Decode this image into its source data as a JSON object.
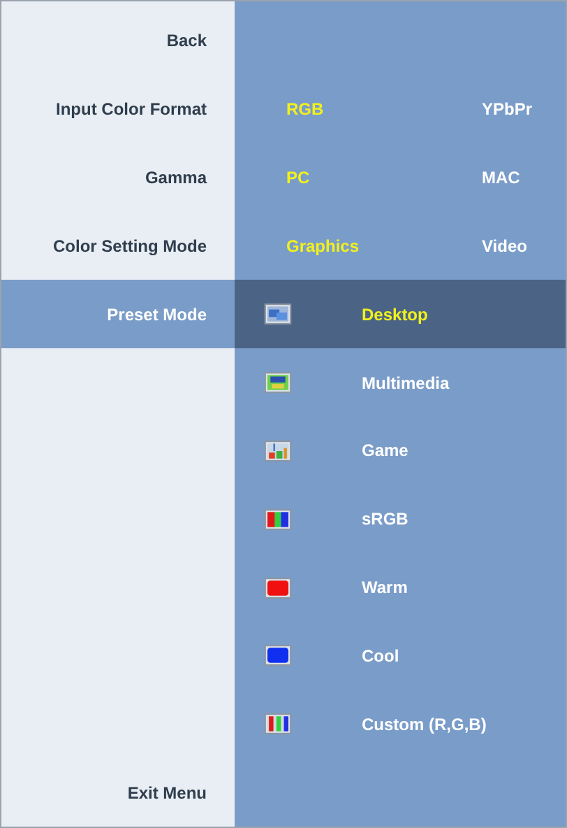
{
  "menu_items": [
    {
      "label": "Back",
      "highlighted": false
    },
    {
      "label": "Input Color Format",
      "highlighted": false,
      "options": [
        {
          "label": "RGB",
          "selected": true
        },
        {
          "label": "YPbPr",
          "selected": false
        }
      ]
    },
    {
      "label": "Gamma",
      "highlighted": false,
      "options": [
        {
          "label": "PC",
          "selected": true
        },
        {
          "label": "MAC",
          "selected": false
        }
      ]
    },
    {
      "label": "Color Setting Mode",
      "highlighted": false,
      "options": [
        {
          "label": "Graphics",
          "selected": true
        },
        {
          "label": "Video",
          "selected": false
        }
      ]
    },
    {
      "label": "Preset Mode",
      "highlighted": true,
      "presets": [
        {
          "label": "Desktop",
          "kind": "desktop",
          "selected": true
        },
        {
          "label": "Multimedia",
          "kind": "multimedia",
          "selected": false
        },
        {
          "label": "Game",
          "kind": "game",
          "selected": false
        },
        {
          "label": "sRGB",
          "kind": "srgb",
          "selected": false
        },
        {
          "label": "Warm",
          "kind": "warm",
          "selected": false
        },
        {
          "label": "Cool",
          "kind": "cool",
          "selected": false
        },
        {
          "label": "Custom (R,G,B)",
          "kind": "custom",
          "selected": false
        }
      ]
    }
  ],
  "exit": {
    "label": "Exit Menu"
  }
}
